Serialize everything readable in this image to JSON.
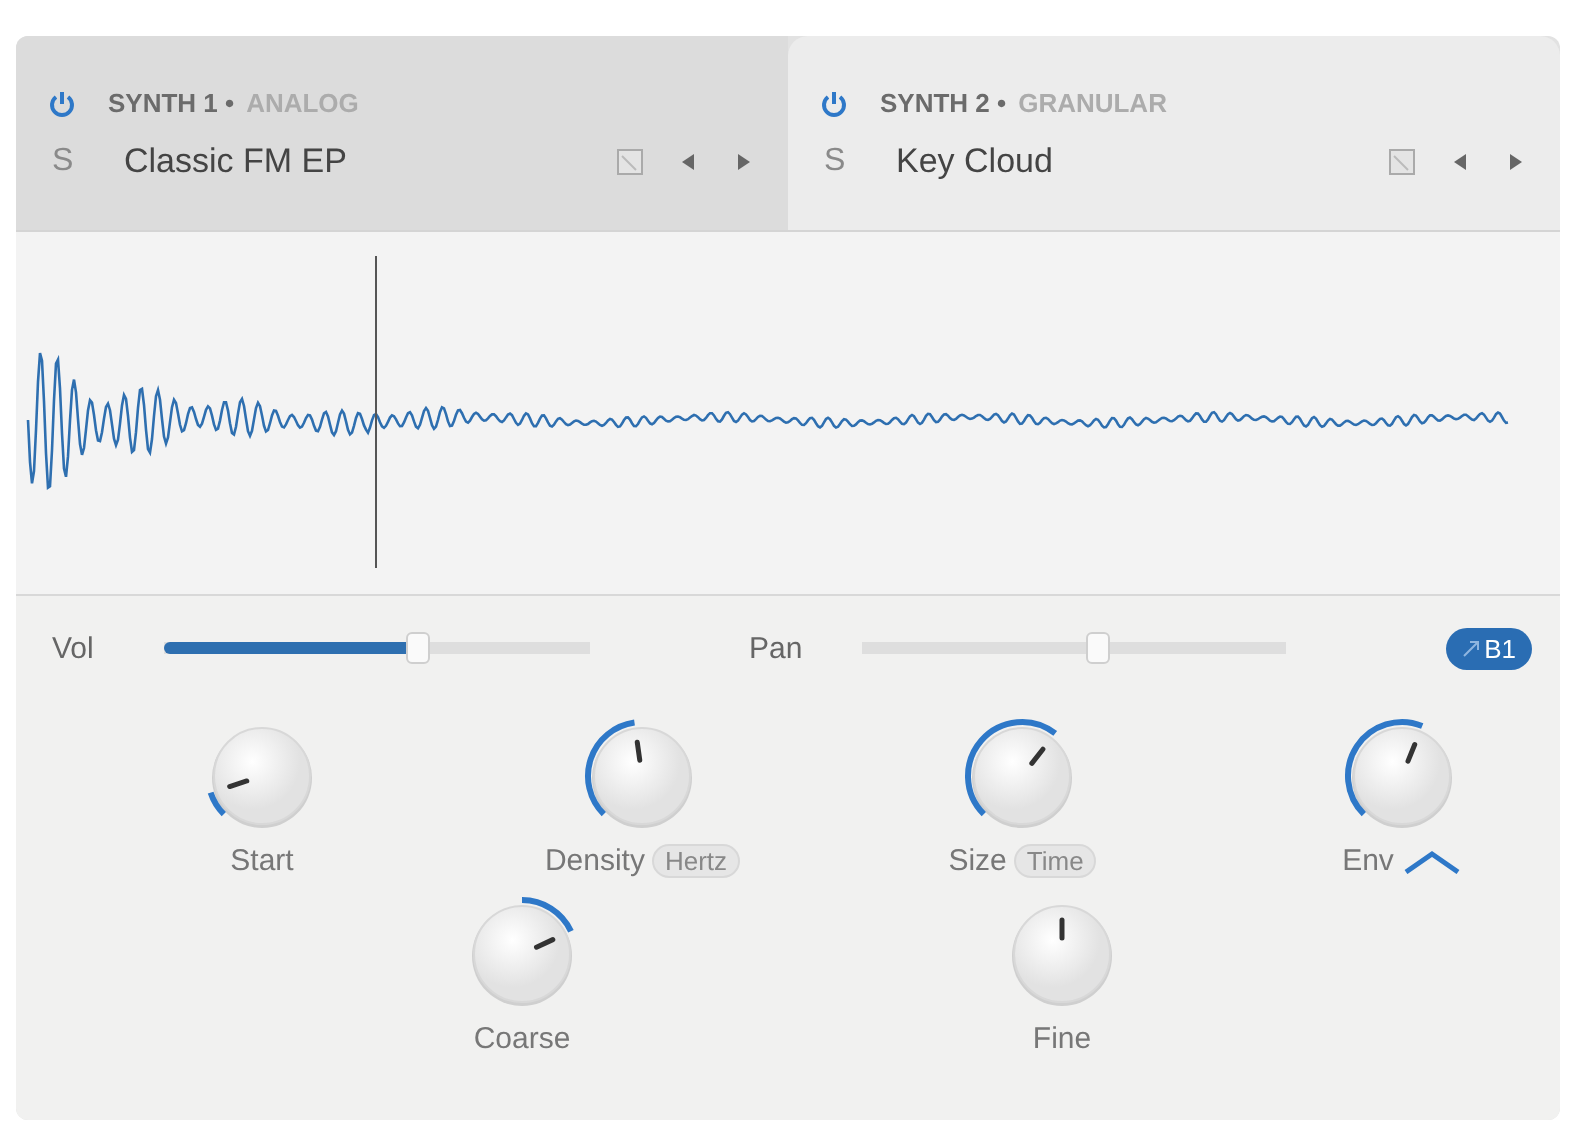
{
  "tabs": [
    {
      "name": "SYNTH 1 •",
      "engine": "ANALOG",
      "solo": "S",
      "preset": "Classic FM EP",
      "power": true,
      "selected": false
    },
    {
      "name": "SYNTH 2 •",
      "engine": "GRANULAR",
      "solo": "S",
      "preset": "Key Cloud",
      "power": true,
      "selected": true
    }
  ],
  "sliders": [
    {
      "label": "Vol",
      "kind": "fill"
    },
    {
      "label": "Pan",
      "kind": "center"
    }
  ],
  "badge": "B1",
  "knobs": [
    {
      "label": "Start"
    },
    {
      "label": "Density",
      "tag": "Hertz"
    },
    {
      "label": "Size",
      "tag": "Time"
    },
    {
      "label": "Env",
      "caret": true
    }
  ],
  "knobs_2": [
    {
      "label": "Coarse"
    },
    {
      "label": "Fine"
    }
  ]
}
